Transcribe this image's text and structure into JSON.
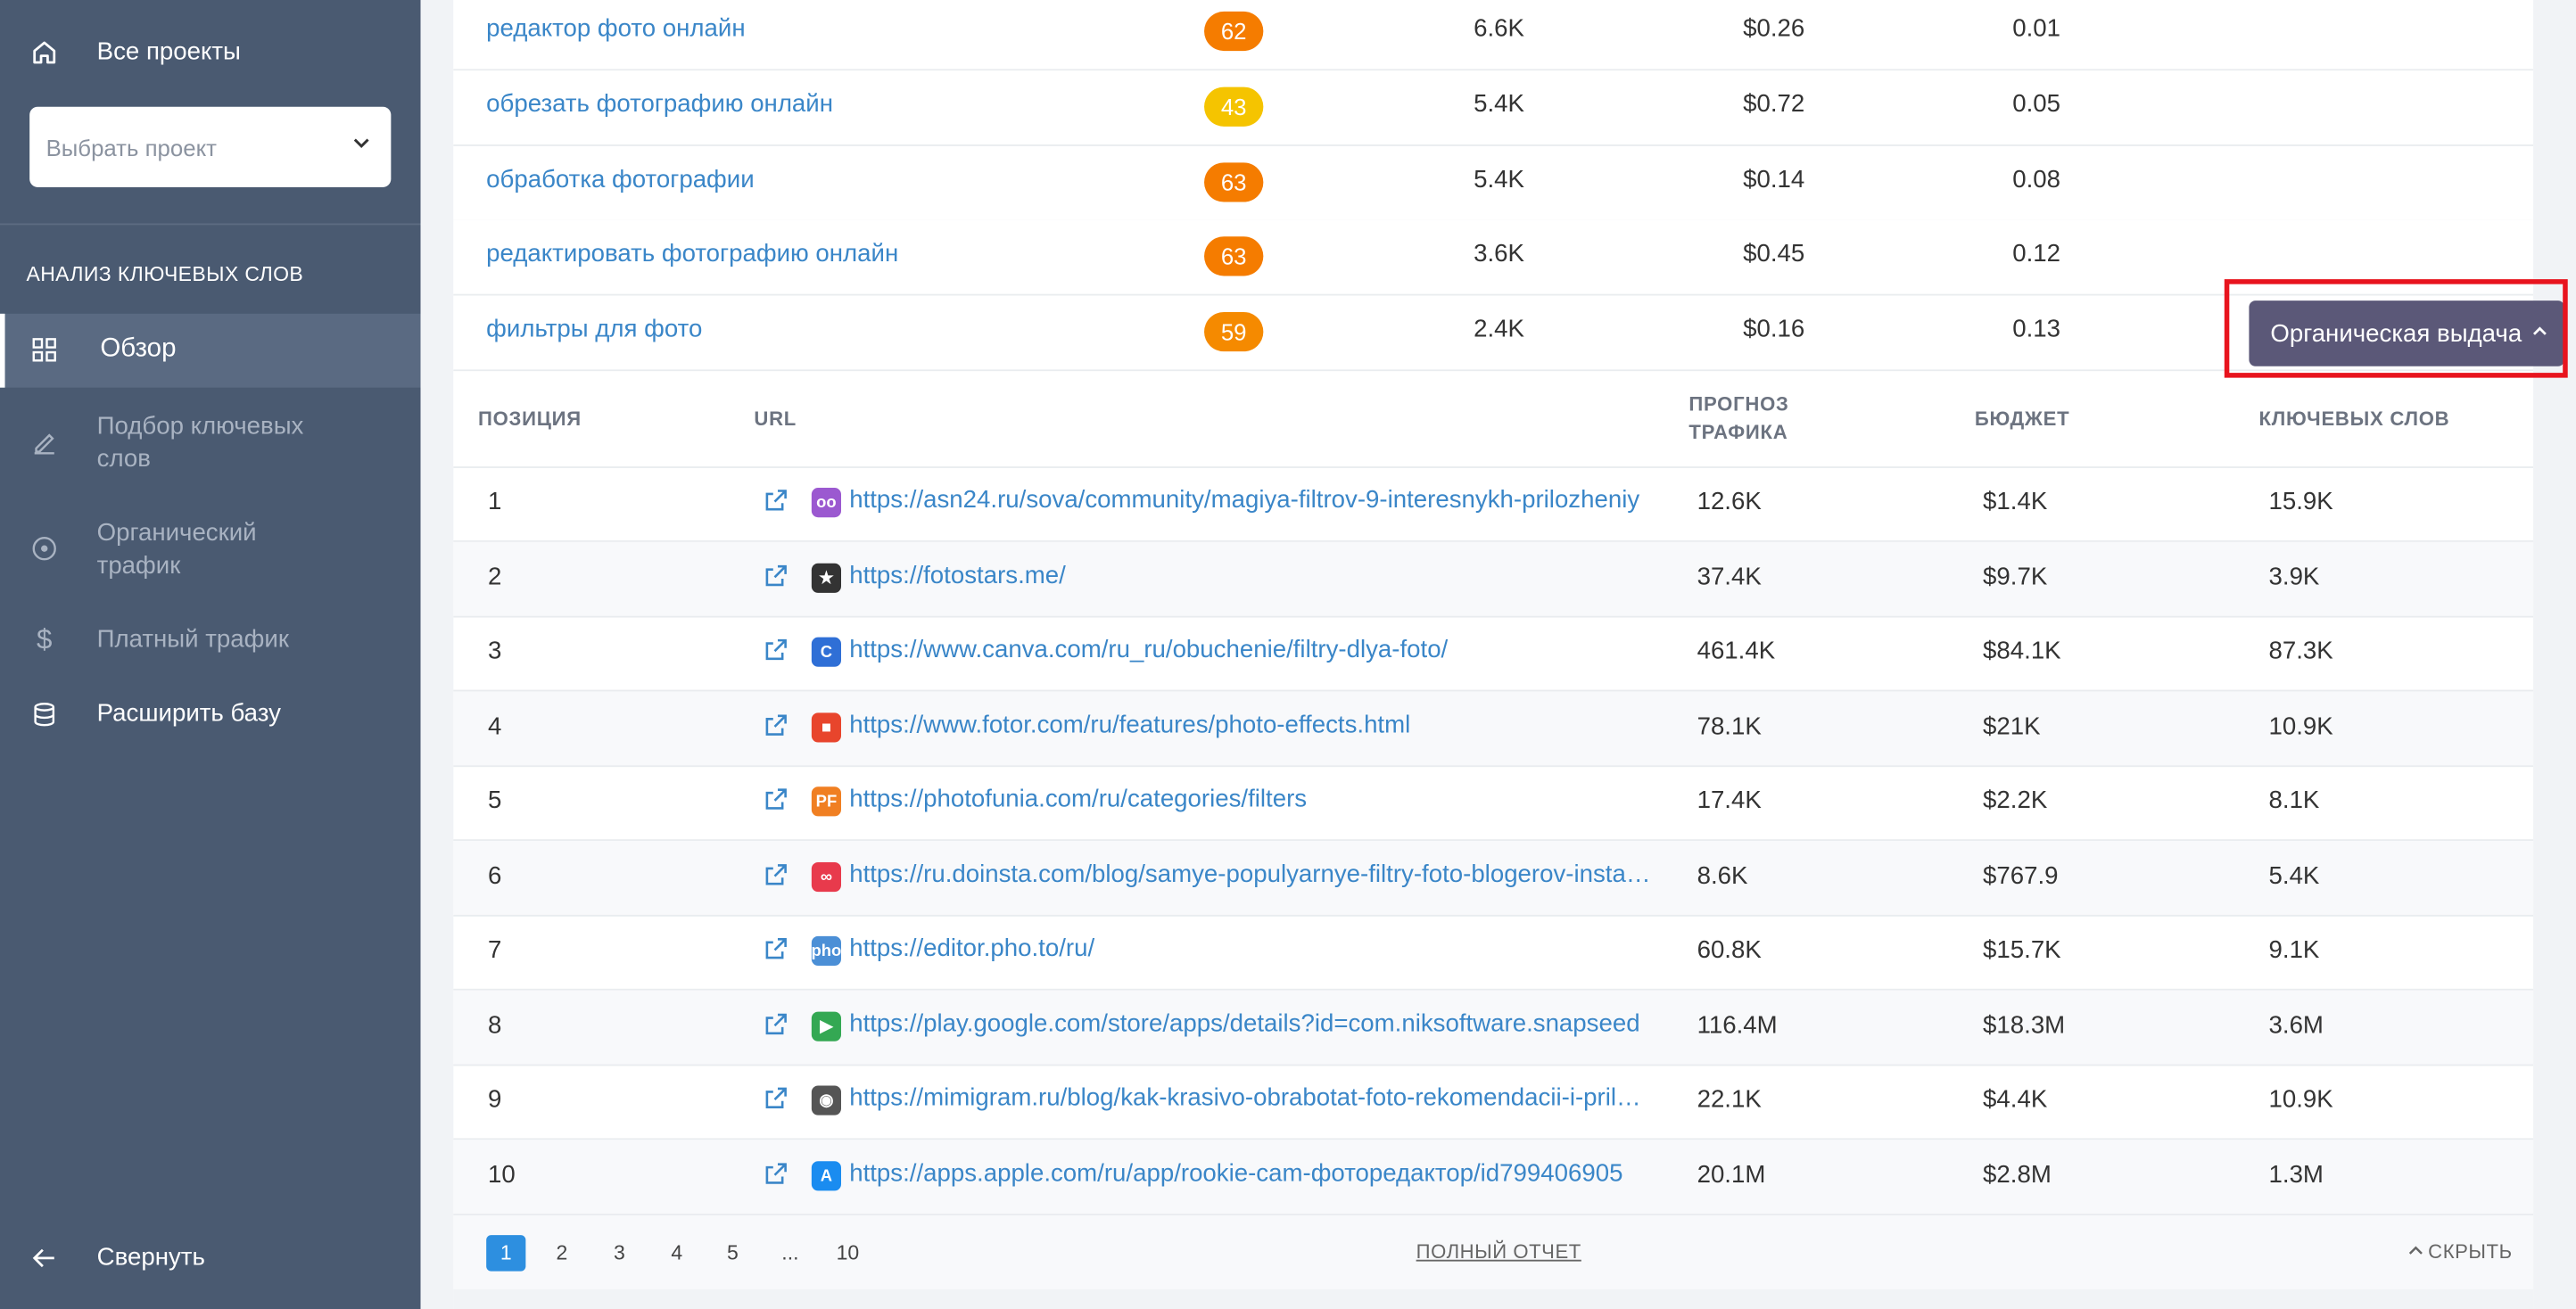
{
  "sidebar": {
    "all_projects": "Все проекты",
    "project_select_placeholder": "Выбрать проект",
    "section_title": "АНАЛИЗ КЛЮЧЕВЫХ СЛОВ",
    "items": [
      {
        "label": "Обзор",
        "icon": "grid-icon",
        "active": true
      },
      {
        "label": "Подбор ключевых слов",
        "icon": "pencil-icon"
      },
      {
        "label": "Органический трафик",
        "icon": "target-icon"
      },
      {
        "label": "Платный трафик",
        "icon": "dollar-icon"
      },
      {
        "label": "Расширить базу",
        "icon": "database-icon"
      }
    ],
    "collapse_label": "Свернуть"
  },
  "keywords": [
    {
      "keyword": "редактор фото онлайн",
      "difficulty": "62",
      "difficulty_color": "#f57c00",
      "volume": "6.6K",
      "cpc": "$0.26",
      "competition": "0.01"
    },
    {
      "keyword": "обрезать фотографию онлайн",
      "difficulty": "43",
      "difficulty_color": "#f5c400",
      "volume": "5.4K",
      "cpc": "$0.72",
      "competition": "0.05"
    },
    {
      "keyword": "обработка фотографии",
      "difficulty": "63",
      "difficulty_color": "#f57c00",
      "volume": "5.4K",
      "cpc": "$0.14",
      "competition": "0.08"
    },
    {
      "keyword": "редактировать фотографию онлайн",
      "difficulty": "63",
      "difficulty_color": "#f57c00",
      "volume": "3.6K",
      "cpc": "$0.45",
      "competition": "0.12"
    },
    {
      "keyword": "фильтры для фото",
      "difficulty": "59",
      "difficulty_color": "#f58a00",
      "volume": "2.4K",
      "cpc": "$0.16",
      "competition": "0.13"
    }
  ],
  "serp_button": "Органическая выдача",
  "serp_table": {
    "headers": {
      "position": "ПОЗИЦИЯ",
      "url": "URL",
      "traffic_line1": "ПРОГНОЗ",
      "traffic_line2": "ТРАФИКА",
      "budget": "БЮДЖЕТ",
      "keywords": "КЛЮЧЕВЫХ СЛОВ"
    },
    "rows": [
      {
        "position": "1",
        "url": "https://asn24.ru/sova/community/magiya-filtrov-9-interesnykh-prilozheniy",
        "traffic": "12.6K",
        "budget": "$1.4K",
        "keywords": "15.9K",
        "favicon": "owl-icon",
        "fav_color": "#9b59d0"
      },
      {
        "position": "2",
        "url": "https://fotostars.me/",
        "traffic": "37.4K",
        "budget": "$9.7K",
        "keywords": "3.9K",
        "favicon": "star-icon",
        "fav_color": "#333333"
      },
      {
        "position": "3",
        "url": "https://www.canva.com/ru_ru/obuchenie/filtry-dlya-foto/",
        "traffic": "461.4K",
        "budget": "$84.1K",
        "keywords": "87.3K",
        "favicon": "canva-icon",
        "fav_color": "#2f6fd6"
      },
      {
        "position": "4",
        "url": "https://www.fotor.com/ru/features/photo-effects.html",
        "traffic": "78.1K",
        "budget": "$21K",
        "keywords": "10.9K",
        "favicon": "fotor-icon",
        "fav_color": "#e8452c"
      },
      {
        "position": "5",
        "url": "https://photofunia.com/ru/categories/filters",
        "traffic": "17.4K",
        "budget": "$2.2K",
        "keywords": "8.1K",
        "favicon": "photofunia-icon",
        "fav_color": "#f07f22"
      },
      {
        "position": "6",
        "url": "https://ru.doinsta.com/blog/samye-populyarnye-filtry-foto-blogerov-instagram",
        "traffic": "8.6K",
        "budget": "$767.9",
        "keywords": "5.4K",
        "favicon": "doinsta-icon",
        "fav_color": "#e83a4c"
      },
      {
        "position": "7",
        "url": "https://editor.pho.to/ru/",
        "traffic": "60.8K",
        "budget": "$15.7K",
        "keywords": "9.1K",
        "favicon": "phoeditor-icon",
        "fav_color": "#4b8fd6"
      },
      {
        "position": "8",
        "url": "https://play.google.com/store/apps/details?id=com.niksoftware.snapseed",
        "traffic": "116.4M",
        "budget": "$18.3M",
        "keywords": "3.6M",
        "favicon": "google-play-icon",
        "fav_color": "#34a853"
      },
      {
        "position": "9",
        "url": "https://mimigram.ru/blog/kak-krasivo-obrabotat-foto-rekomendacii-i-prilozheniya",
        "traffic": "22.1K",
        "budget": "$4.4K",
        "keywords": "10.9K",
        "favicon": "mimigram-icon",
        "fav_color": "#555555"
      },
      {
        "position": "10",
        "url": "https://apps.apple.com/ru/app/rookie-cam-фоторедактор/id799406905",
        "traffic": "20.1M",
        "budget": "$2.8M",
        "keywords": "1.3M",
        "favicon": "app-store-icon",
        "fav_color": "#1a8cf0"
      }
    ]
  },
  "pagination": {
    "pages": [
      "1",
      "2",
      "3",
      "4",
      "5",
      "...",
      "10"
    ],
    "current": "1",
    "full_report": "ПОЛНЫЙ ОТЧЕТ",
    "hide": "СКРЫТЬ"
  },
  "colors": {
    "sidebar_bg": "#4a5a71",
    "link": "#3a86c8",
    "button_bg": "#5b5878",
    "highlight": "#e8141e",
    "pager_active": "#2d8fe0"
  }
}
